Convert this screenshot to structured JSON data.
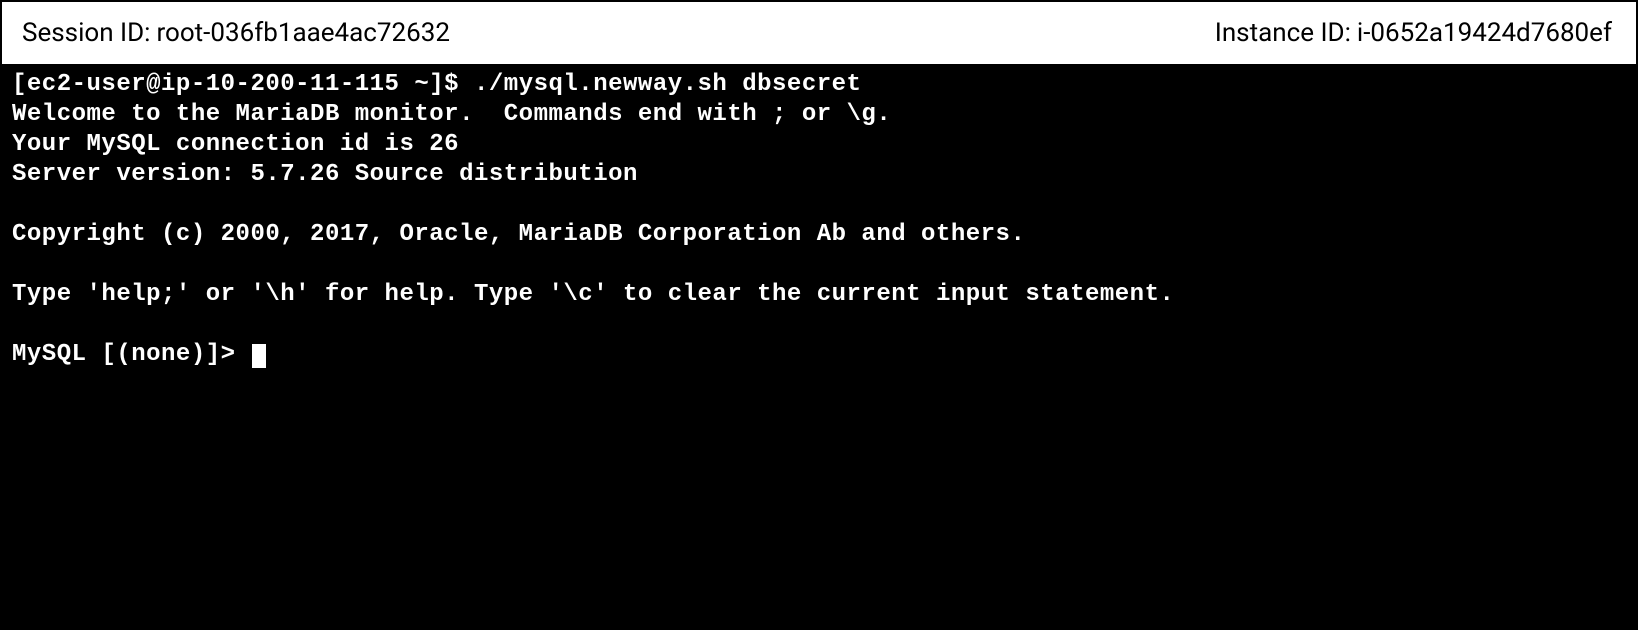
{
  "header": {
    "session_label": "Session ID:",
    "session_value": "root-036fb1aae4ac72632",
    "instance_label": "Instance ID:",
    "instance_value": "i-0652a19424d7680ef"
  },
  "terminal": {
    "line1_prompt": "[ec2-user@ip-10-200-11-115 ~]$ ",
    "line1_cmd": "./mysql.newway.sh dbsecret",
    "line2": "Welcome to the MariaDB monitor.  Commands end with ; or \\g.",
    "line3": "Your MySQL connection id is 26",
    "line4": "Server version: 5.7.26 Source distribution",
    "line5": "Copyright (c) 2000, 2017, Oracle, MariaDB Corporation Ab and others.",
    "line6": "Type 'help;' or '\\h' for help. Type '\\c' to clear the current input statement.",
    "line7_prompt": "MySQL [(none)]> "
  }
}
